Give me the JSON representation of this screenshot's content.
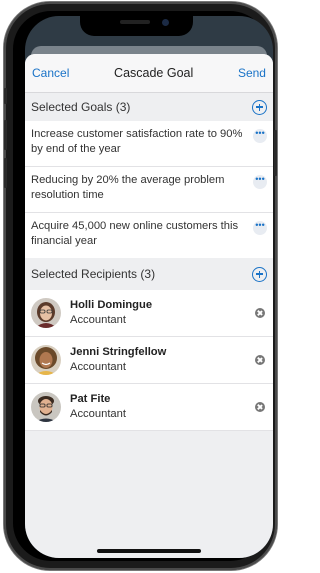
{
  "navbar": {
    "cancel_label": "Cancel",
    "title": "Cascade Goal",
    "send_label": "Send"
  },
  "goals": {
    "header": "Selected Goals (3)",
    "items": [
      {
        "text": "Increase customer satisfaction rate to 90% by end of the year"
      },
      {
        "text": "Reducing by 20% the average problem resolution time"
      },
      {
        "text": "Acquire 45,000 new online customers  this financial year"
      }
    ]
  },
  "recipients": {
    "header": "Selected Recipients (3)",
    "items": [
      {
        "name": "Holli Domingue",
        "role": "Accountant"
      },
      {
        "name": "Jenni Stringfellow",
        "role": "Accountant"
      },
      {
        "name": "Pat Fite",
        "role": "Accountant"
      }
    ]
  },
  "colors": {
    "accent": "#1a73c7",
    "background": "#eeeff1",
    "device": "#1b1b1b"
  },
  "icons": {
    "add": "add-circle-icon",
    "more": "more-horizontal-icon",
    "remove": "remove-circle-icon"
  }
}
